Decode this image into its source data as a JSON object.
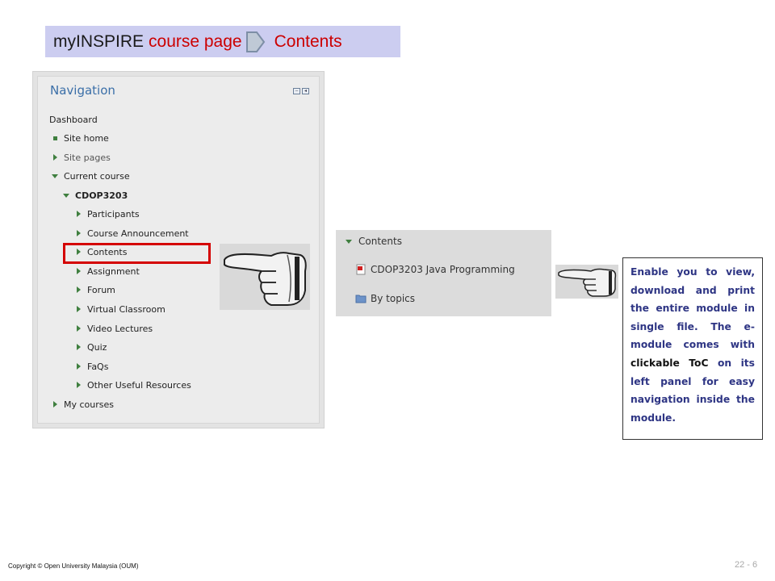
{
  "title": {
    "app": "myINSPIRE",
    "page": "course page",
    "section": "Contents",
    "arrow_icon": "chevron-right-icon"
  },
  "navigation": {
    "header": "Navigation",
    "items": [
      {
        "label": "Dashboard",
        "bullet": "none"
      },
      {
        "label": "Site home",
        "bullet": "square"
      },
      {
        "label": "Site pages",
        "bullet": "tri-right"
      },
      {
        "label": "Current course",
        "bullet": "tri-down"
      },
      {
        "label": "CDOP3203",
        "bullet": "tri-down"
      },
      {
        "label": "Participants",
        "bullet": "tri-right"
      },
      {
        "label": "Course Announcement",
        "bullet": "tri-right"
      },
      {
        "label": "Contents",
        "bullet": "tri-right"
      },
      {
        "label": "Assignment",
        "bullet": "tri-right"
      },
      {
        "label": "Forum",
        "bullet": "tri-right"
      },
      {
        "label": "Virtual Classroom",
        "bullet": "tri-right"
      },
      {
        "label": "Video Lectures",
        "bullet": "tri-right"
      },
      {
        "label": "Quiz",
        "bullet": "tri-right"
      },
      {
        "label": "FaQs",
        "bullet": "tri-right"
      },
      {
        "label": "Other Useful Resources",
        "bullet": "tri-right"
      },
      {
        "label": "My courses",
        "bullet": "tri-right"
      }
    ]
  },
  "contents_panel": {
    "header": "Contents",
    "items": [
      {
        "label": "CDOP3203 Java Programming",
        "icon": "pdf-file-icon"
      },
      {
        "label": "By topics",
        "icon": "folder-icon"
      }
    ]
  },
  "description": {
    "part1": "Enable you to view, download and print the entire module in single file. The e-module comes with ",
    "emphasis": "clickable ToC",
    "part2": " on its left panel for easy navigation inside the module."
  },
  "footer": {
    "copyright": "Copyright © Open University Malaysia (OUM)",
    "page_number": "22 - 6"
  },
  "colors": {
    "title_bg": "#cccdf0",
    "accent_red": "#cc0000",
    "highlight_red": "#d40000",
    "nav_header": "#3b6fa8",
    "description_text": "#2e3584",
    "bullet_green": "#3f7f3f"
  }
}
